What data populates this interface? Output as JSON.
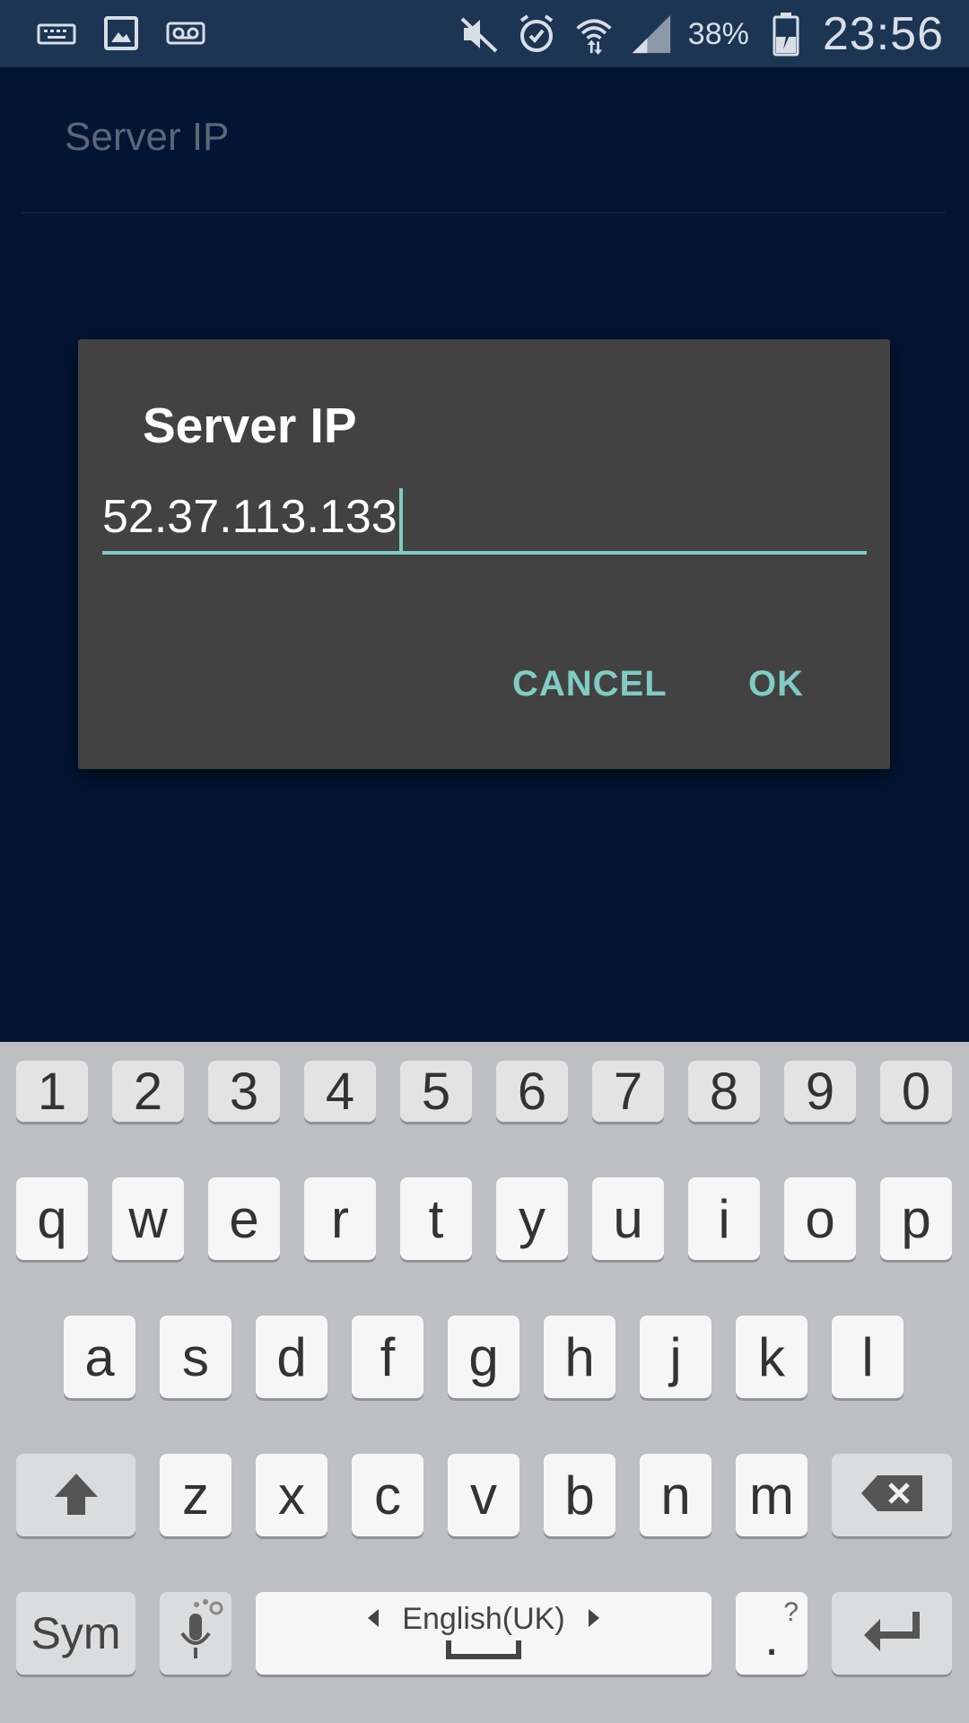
{
  "status_bar": {
    "left_icons": [
      "keyboard-icon",
      "image-icon",
      "voicemail-icon"
    ],
    "right_icons": [
      "mute-icon",
      "alarm-icon",
      "wifi-icon",
      "signal-icon",
      "battery-charging-icon"
    ],
    "battery_percent": "38%",
    "time": "23:56"
  },
  "background": {
    "preference_title": "Server IP"
  },
  "dialog": {
    "title": "Server IP",
    "input_value": "52.37.113.133",
    "cancel_label": "CANCEL",
    "ok_label": "OK",
    "accent_color": "#80cbc4"
  },
  "keyboard": {
    "number_row": [
      "1",
      "2",
      "3",
      "4",
      "5",
      "6",
      "7",
      "8",
      "9",
      "0"
    ],
    "row1": [
      "q",
      "w",
      "e",
      "r",
      "t",
      "y",
      "u",
      "i",
      "o",
      "p"
    ],
    "row2": [
      "a",
      "s",
      "d",
      "f",
      "g",
      "h",
      "j",
      "k",
      "l"
    ],
    "row3": [
      "z",
      "x",
      "c",
      "v",
      "b",
      "n",
      "m"
    ],
    "sym_label": "Sym",
    "language_label": "English(UK)",
    "period_label": ".",
    "period_hint": "?"
  }
}
